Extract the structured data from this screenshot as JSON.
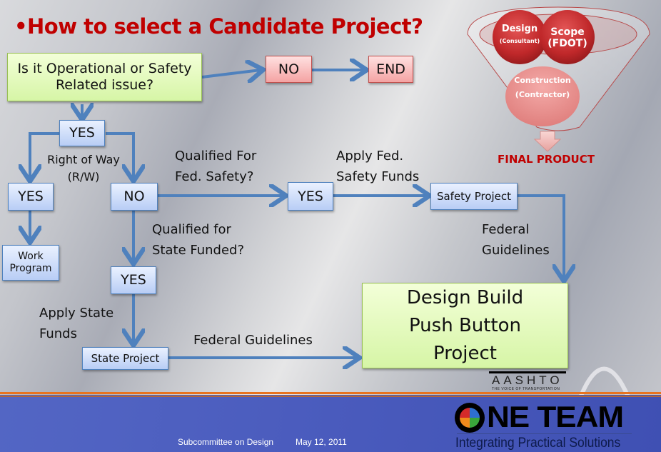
{
  "title": "•How to select a Candidate Project?",
  "flowchart": {
    "start_question": "Is it Operational or Safety Related issue?",
    "no_box": "NO",
    "end_box": "END",
    "yes_box_1": "YES",
    "right_of_way_label": "Right of Way (R/W)",
    "row_yes_box": "YES",
    "row_no_box": "NO",
    "work_program_box": "Work Program",
    "qualified_fed_label": "Qualified For Fed. Safety?",
    "fed_yes_box": "YES",
    "apply_fed_label": "Apply Fed. Safety Funds",
    "safety_project_box": "Safety Project",
    "federal_guidelines_label_1": "Federal Guidelines",
    "qualified_state_label": "Qualified for State Funded?",
    "state_yes_box": "YES",
    "apply_state_label": "Apply State Funds",
    "state_project_box": "State Project",
    "federal_guidelines_label_2": "Federal Guidelines",
    "final_box": "Design Build Push Button Project"
  },
  "funnel": {
    "design": "Design",
    "design_sub": "(Consultant)",
    "scope": "Scope",
    "scope_sub": "(FDOT)",
    "construction": "Construction",
    "construction_sub": "(Contractor)",
    "final_product": "FINAL PRODUCT"
  },
  "footer": {
    "committee": "Subcommittee on Design",
    "date": "May 12, 2011",
    "brand": "ONE TEAM",
    "brand_letters": "NE TEAM",
    "tagline": "Integrating Practical Solutions",
    "aashto": "AASHTO",
    "aashto_sub": "THE VOICE OF TRANSPORTATION"
  },
  "colors": {
    "title": "#c00000",
    "arrow": "#4f81bd",
    "footer_bg": "#4a5bbd",
    "footer_stripe": "#e8731f"
  }
}
